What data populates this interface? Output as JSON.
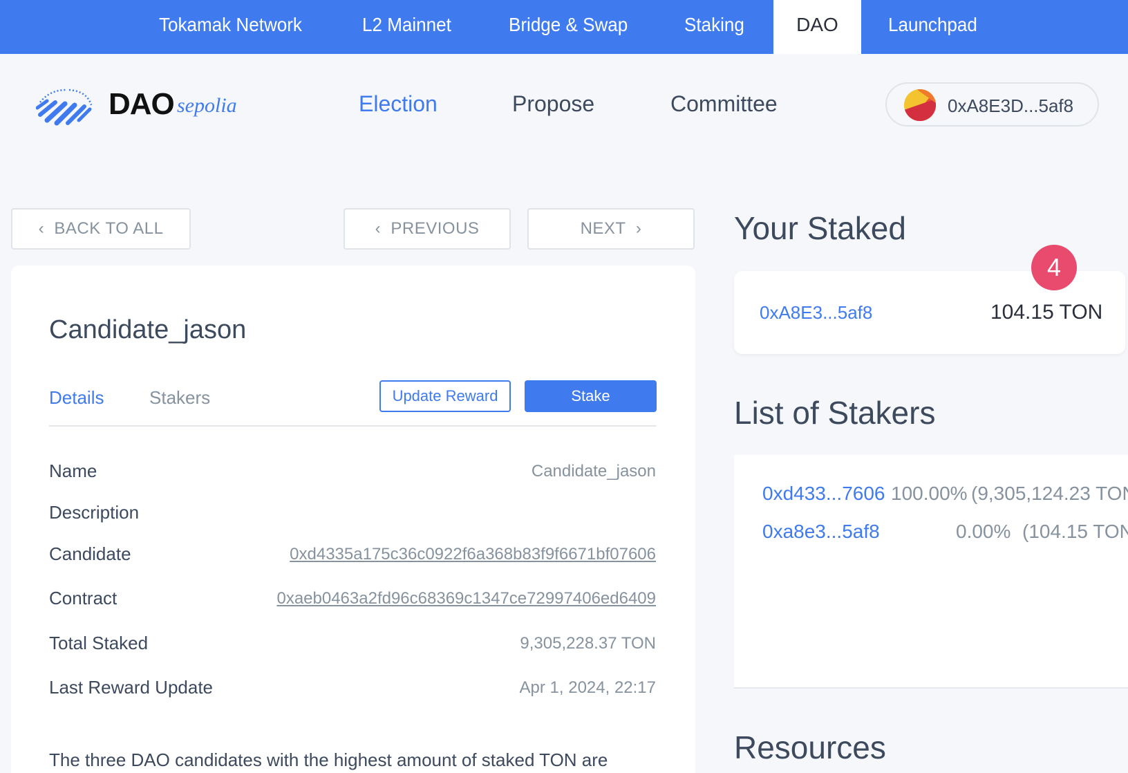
{
  "topnav": {
    "items": [
      "Tokamak Network",
      "L2 Mainnet",
      "Bridge & Swap",
      "Staking",
      "DAO",
      "Launchpad"
    ],
    "active": "DAO"
  },
  "header": {
    "logo_text": "DAO",
    "logo_sub": "sepolia",
    "nav": [
      "Election",
      "Propose",
      "Committee"
    ],
    "active_nav": "Election",
    "wallet_address": "0xA8E3D...5af8"
  },
  "navigation": {
    "back": "BACK TO ALL",
    "previous": "PREVIOUS",
    "next": "NEXT"
  },
  "candidate": {
    "title": "Candidate_jason",
    "tabs": [
      "Details",
      "Stakers"
    ],
    "active_tab": "Details",
    "update_reward_label": "Update Reward",
    "stake_label": "Stake",
    "details": [
      {
        "label": "Name",
        "value": "Candidate_jason"
      },
      {
        "label": "Description",
        "value": ""
      },
      {
        "label": "Candidate",
        "value": "0xd4335a175c36c0922f6a368b83f9f6671bf07606"
      },
      {
        "label": "Contract",
        "value": "0xaeb0463a2fd96c68369c1347ce72997406ed6409"
      },
      {
        "label": "Total Staked",
        "value": "9,305,228.37 TON"
      },
      {
        "label": "Last Reward Update",
        "value": "Apr 1, 2024, 22:17"
      }
    ],
    "paragraph": "The three DAO candidates with the highest amount of staked TON are"
  },
  "sidebar": {
    "your_staked_title": "Your Staked",
    "badge_count": "4",
    "your_staked_address": "0xA8E3...5af8",
    "your_staked_amount": "104.15 TON",
    "stakers_title": "List of Stakers",
    "stakers": [
      {
        "address": "0xd433...7606",
        "percent": "100.00%",
        "amount": "(9,305,124.23 TON"
      },
      {
        "address": "0xa8e3...5af8",
        "percent": "0.00%",
        "amount": "(104.15 TON"
      }
    ],
    "resources_title": "Resources"
  },
  "colors": {
    "accent": "#3f7bef",
    "badge": "#e94b6f",
    "text": "#3d495d",
    "muted": "#86929d"
  },
  "icons": [
    "dao-logo-icon",
    "wallet-avatar-icon",
    "chevron-left-icon",
    "chevron-right-icon"
  ]
}
